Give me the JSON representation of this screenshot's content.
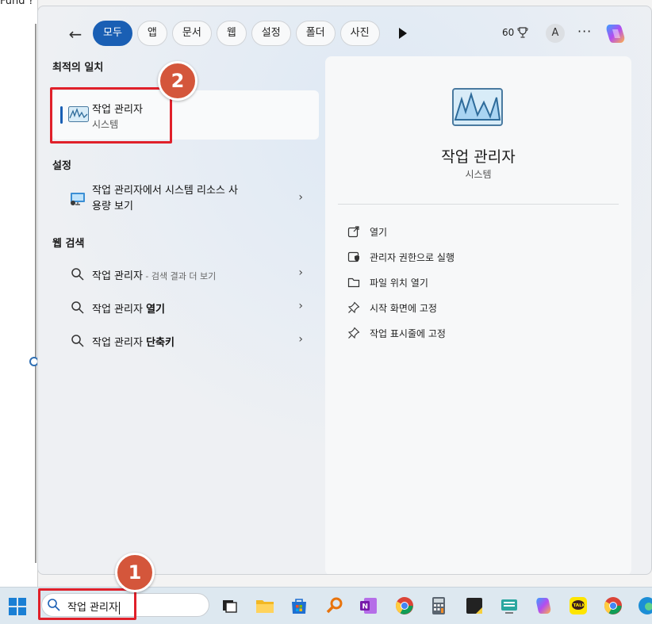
{
  "background": {
    "fragment_text": "Fund  ?"
  },
  "panel": {
    "back_label": "←",
    "tabs": [
      "모두",
      "앱",
      "문서",
      "웹",
      "설정",
      "폴더",
      "사진"
    ],
    "points": "60",
    "avatar_letter": "A",
    "more_label": "···"
  },
  "left": {
    "best_match_heading": "최적의 일치",
    "best_match": {
      "title": "작업 관리자",
      "subtitle": "시스템"
    },
    "settings_heading": "설정",
    "settings_item": {
      "line1": "작업 관리자에서 시스템 리소스 사",
      "line2": "용량 보기"
    },
    "web_heading": "웹 검색",
    "web_items": [
      {
        "prefix": "작업 관리자",
        "suffix": " - 검색 결과 더 보기",
        "bold": ""
      },
      {
        "prefix": "작업 관리자 ",
        "suffix": "",
        "bold": "열기"
      },
      {
        "prefix": "작업 관리자 ",
        "suffix": "",
        "bold": "단축키"
      }
    ]
  },
  "right": {
    "title": "작업 관리자",
    "subtitle": "시스템",
    "actions": [
      "열기",
      "관리자 권한으로 실행",
      "파일 위치 열기",
      "시작 화면에 고정",
      "작업 표시줄에 고정"
    ]
  },
  "annotations": {
    "step1": "1",
    "step2": "2"
  },
  "taskbar": {
    "search_value": "작업 관리자"
  },
  "colors": {
    "accent": "#1a5fb4",
    "annotation_red": "#e0202a",
    "badge": "#d4563b"
  }
}
